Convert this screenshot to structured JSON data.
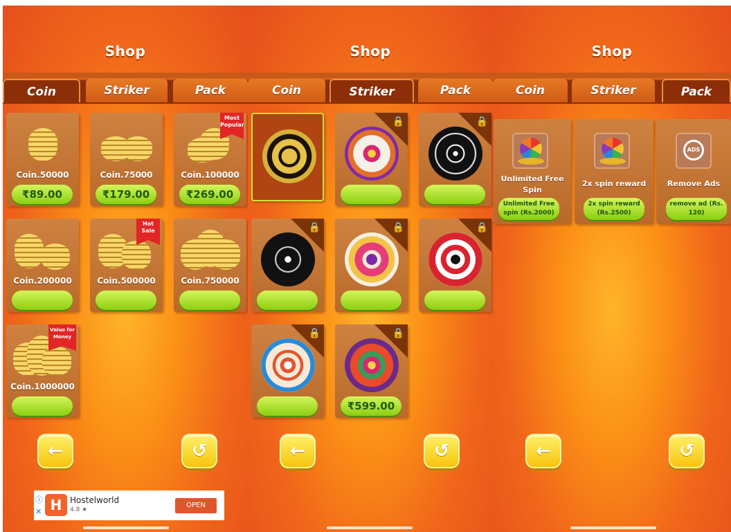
{
  "panels": [
    {
      "title": "Shop",
      "tabs": [
        "Coin",
        "Striker",
        "Pack"
      ],
      "active_tab": "Coin",
      "items": [
        {
          "label": "Coin.50000",
          "price": "₹89.00"
        },
        {
          "label": "Coin.75000",
          "price": "₹179.00"
        },
        {
          "label": "Coin.100000",
          "price": "₹269.00",
          "ribbon": "Most Popular"
        },
        {
          "label": "Coin.200000",
          "price": ""
        },
        {
          "label": "Coin.500000",
          "price": "",
          "ribbon": "Hot Sale"
        },
        {
          "label": "Coin.750000",
          "price": ""
        },
        {
          "label": "Coin.1000000",
          "price": "",
          "ribbon": "Value for Money"
        }
      ]
    },
    {
      "title": "Shop",
      "tabs": [
        "Coin",
        "Striker",
        "Pack"
      ],
      "active_tab": "Striker",
      "items": [
        {
          "design": "gold-tribal-striker",
          "locked": false,
          "selected": true,
          "price": ""
        },
        {
          "design": "purple-mandala-striker",
          "locked": true,
          "price": ""
        },
        {
          "design": "black-snowflake-striker",
          "locked": true,
          "price": ""
        },
        {
          "design": "black-compass-striker",
          "locked": true,
          "price": ""
        },
        {
          "design": "orange-flower-striker",
          "locked": true,
          "price": ""
        },
        {
          "design": "red-ring-striker",
          "locked": true,
          "price": ""
        },
        {
          "design": "blue-ring-striker",
          "locked": true,
          "price": ""
        },
        {
          "design": "pink-mandala-striker",
          "locked": true,
          "price": "₹599.00"
        }
      ]
    },
    {
      "title": "Shop",
      "tabs": [
        "Coin",
        "Striker",
        "Pack"
      ],
      "active_tab": "Pack",
      "items": [
        {
          "label": "Unlimited Free Spin",
          "price": "Unlimited Free spin (Rs.2000)",
          "icon": "spin-wheel-icon"
        },
        {
          "label": "2x spin reward",
          "price": "2x spin reward (Rs.2500)",
          "icon": "spin-wheel-icon"
        },
        {
          "label": "Remove Ads",
          "price": "remove ad (Rs. 120)",
          "icon": "no-ads-icon",
          "icon_text": "ADS"
        }
      ]
    }
  ],
  "ad": {
    "name": "Hostelworld",
    "rating": "4.8 ★",
    "button": "OPEN",
    "logo_letter": "H",
    "info_glyph": "ⓘ",
    "close_glyph": "✕"
  },
  "lock_glyph": "🔒",
  "nav": {
    "back_glyph": "←",
    "restore_glyph": "↺"
  },
  "colors": {
    "accent_green": "#a8e02a",
    "tab_dark": "#8c2e08",
    "ribbon_red": "#e22525"
  }
}
